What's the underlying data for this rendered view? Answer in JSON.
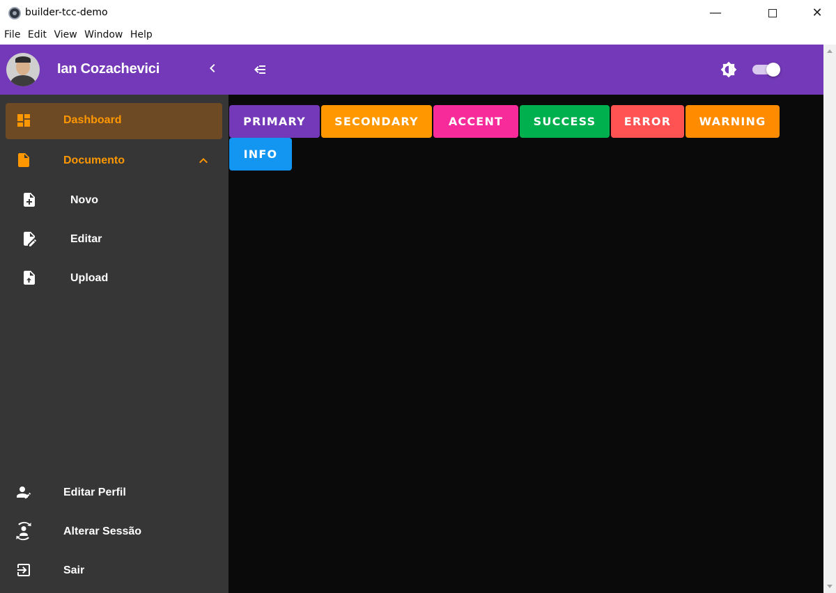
{
  "window": {
    "title": "builder-tcc-demo",
    "minimize": "—",
    "close": "✕"
  },
  "menubar": [
    "File",
    "Edit",
    "View",
    "Window",
    "Help"
  ],
  "user": {
    "name": "Ian Cozachevici"
  },
  "sidebar": {
    "items": [
      {
        "label": "Dashboard",
        "icon": "dashboard-icon",
        "active": true
      },
      {
        "label": "Documento",
        "icon": "document-icon",
        "expanded": true
      },
      {
        "label": "Novo",
        "icon": "file-plus-icon"
      },
      {
        "label": "Editar",
        "icon": "file-edit-icon"
      },
      {
        "label": "Upload",
        "icon": "file-upload-icon"
      }
    ],
    "footer": [
      {
        "label": "Editar Perfil",
        "icon": "account-edit-icon"
      },
      {
        "label": "Alterar Sessão",
        "icon": "account-switch-icon"
      },
      {
        "label": "Sair",
        "icon": "logout-icon"
      }
    ]
  },
  "buttons": [
    {
      "label": "PRIMARY",
      "color": "#7339b8"
    },
    {
      "label": "SECONDARY",
      "color": "#ff9800"
    },
    {
      "label": "ACCENT",
      "color": "#f72b9a"
    },
    {
      "label": "SUCCESS",
      "color": "#00b04f"
    },
    {
      "label": "ERROR",
      "color": "#ff5252"
    },
    {
      "label": "WARNING",
      "color": "#ff8c00"
    },
    {
      "label": "INFO",
      "color": "#1296f1"
    }
  ],
  "theme_toggle": {
    "dark_mode": true
  },
  "colors": {
    "header": "#7339b8",
    "sidebar_bg": "#363636",
    "active_item": "#6e4a24",
    "accent_text": "#ff9800",
    "content_bg": "#0a0a0a"
  }
}
